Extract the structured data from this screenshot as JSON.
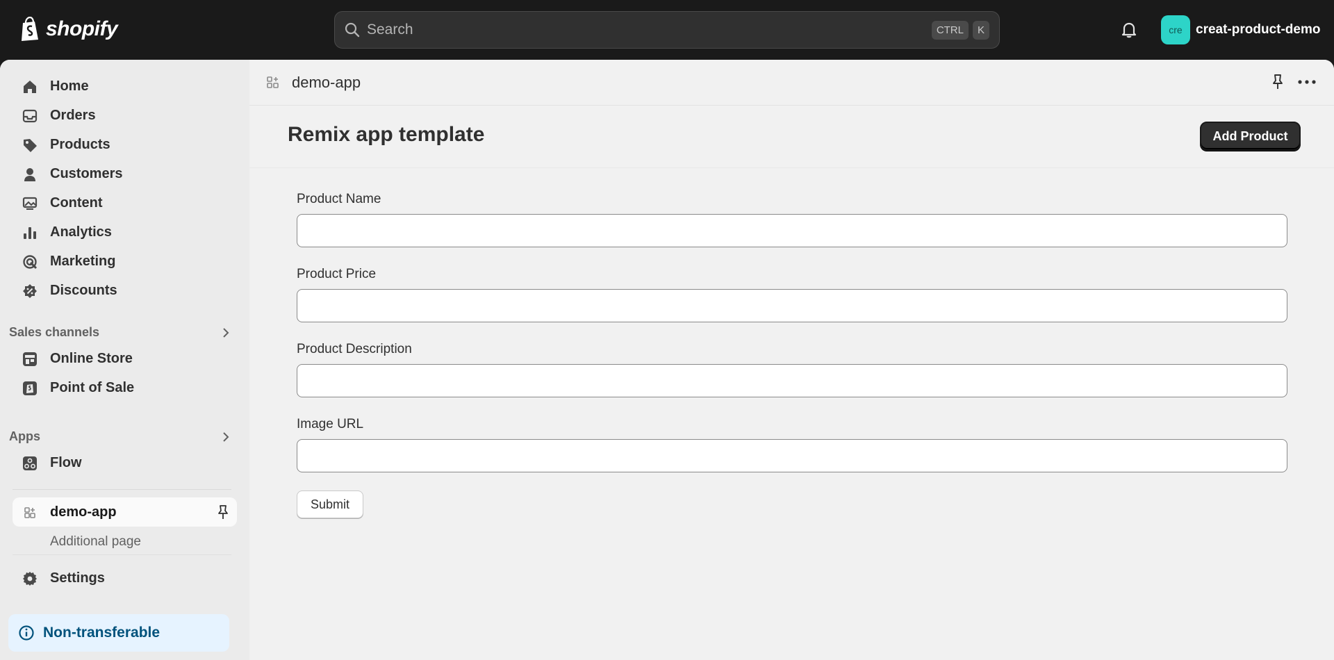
{
  "topbar": {
    "logo_text": "shopify",
    "search_placeholder": "Search",
    "shortcut_keys": [
      "CTRL",
      "K"
    ],
    "store_avatar_text": "cre",
    "store_name": "creat-product-demo"
  },
  "sidebar": {
    "items": [
      {
        "label": "Home",
        "icon": "home-icon"
      },
      {
        "label": "Orders",
        "icon": "orders-icon"
      },
      {
        "label": "Products",
        "icon": "tag-icon"
      },
      {
        "label": "Customers",
        "icon": "person-icon"
      },
      {
        "label": "Content",
        "icon": "image-icon"
      },
      {
        "label": "Analytics",
        "icon": "bar-chart-icon"
      },
      {
        "label": "Marketing",
        "icon": "target-icon"
      },
      {
        "label": "Discounts",
        "icon": "discount-icon"
      }
    ],
    "sales_channels_title": "Sales channels",
    "sales_channels": [
      {
        "label": "Online Store",
        "icon": "store-icon"
      },
      {
        "label": "Point of Sale",
        "icon": "pos-icon"
      }
    ],
    "apps_title": "Apps",
    "apps": [
      {
        "label": "Flow",
        "icon": "flow-icon"
      }
    ],
    "active_app": "demo-app",
    "active_app_subpage": "Additional page",
    "settings_label": "Settings",
    "badge_label": "Non-transferable"
  },
  "main": {
    "app_name": "demo-app",
    "page_title": "Remix app template",
    "primary_action": "Add Product",
    "fields": [
      {
        "label": "Product Name",
        "value": ""
      },
      {
        "label": "Product Price",
        "value": ""
      },
      {
        "label": "Product Description",
        "value": ""
      },
      {
        "label": "Image URL",
        "value": ""
      }
    ],
    "submit_label": "Submit"
  },
  "colors": {
    "topbar_bg": "#1a1a1a",
    "avatar_bg": "#2dd4c8",
    "badge_bg": "#e6f3ff",
    "badge_text": "#00527c",
    "primary_button": "#303030"
  }
}
